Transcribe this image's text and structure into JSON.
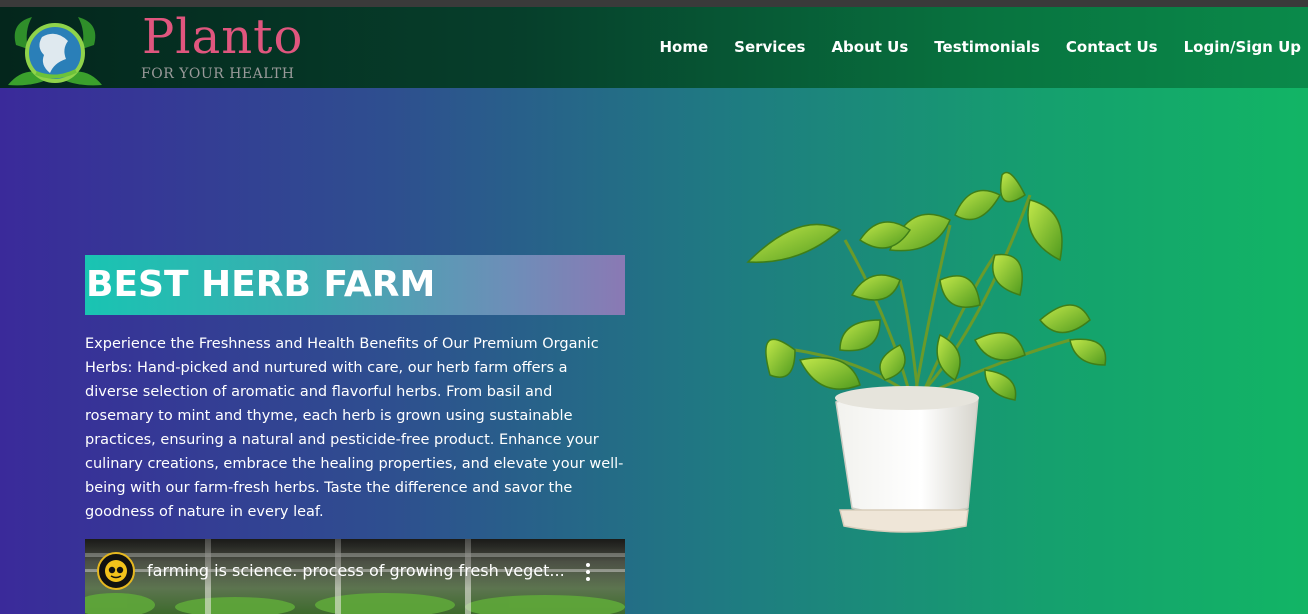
{
  "header": {
    "brand_name": "Planto",
    "brand_tagline": "FOR YOUR HEALTH",
    "logo_icon": "globe-leaf-icon"
  },
  "nav": {
    "items": [
      {
        "label": "Home"
      },
      {
        "label": "Services"
      },
      {
        "label": "About Us"
      },
      {
        "label": "Testimonials"
      },
      {
        "label": "Contact Us"
      },
      {
        "label": "Login/Sign Up"
      }
    ]
  },
  "hero": {
    "title": "BEST HERB FARM",
    "description": "Experience the Freshness and Health Benefits of Our Premium Organic Herbs: Hand-picked and nurtured with care, our herb farm offers a diverse selection of aromatic and flavorful herbs. From basil and rosemary to mint and thyme, each herb is grown using sustainable practices, ensuring a natural and pesticide-free product. Enhance your culinary creations, embrace the healing properties, and elevate your well-being with our farm-fresh herbs. Taste the difference and savor the goodness of nature in every leaf.",
    "image_icon": "potted-plant-image"
  },
  "video": {
    "title": "farming is science. process of growing fresh veget...",
    "channel_icon": "channel-avatar-icon",
    "menu_icon": "more-vertical-icon"
  },
  "colors": {
    "brand": "#e0567e",
    "nav_text": "#ffffff",
    "title_box_start": "#19c4b2",
    "title_box_end": "#8a79b4"
  }
}
